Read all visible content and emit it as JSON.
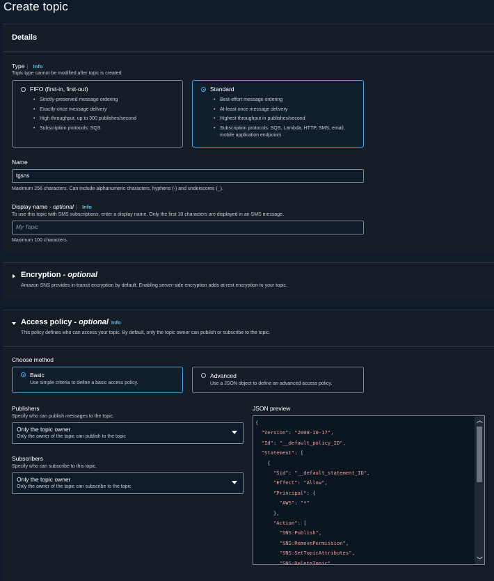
{
  "page": {
    "title": "Create topic"
  },
  "details": {
    "heading": "Details",
    "type": {
      "label": "Type",
      "info": "Info",
      "desc": "Topic type cannot be modified after topic is created",
      "fifo": {
        "title": "FIFO (first-in, first-out)",
        "bullets": [
          "Strictly-preserved message ordering",
          "Exactly-once message delivery",
          "High throughput, up to 300 publishes/second",
          "Subscription protocols: SQS"
        ]
      },
      "standard": {
        "title": "Standard",
        "bullets": [
          "Best-effort message ordering",
          "At-least once message delivery",
          "Highest throughput in publishes/second",
          "Subscription protocols: SQS, Lambda, HTTP, SMS, email, mobile application endpoints"
        ]
      }
    },
    "name": {
      "label": "Name",
      "value": "tgsns",
      "hint": "Maximum 256 characters. Can include alphanumeric characters, hyphens (-) and underscores (_)."
    },
    "display_name": {
      "label": "Display name",
      "optional": "optional",
      "info": "Info",
      "desc": "To use this topic with SMS subscriptions, enter a display name. Only the first 10 characters are displayed in an SMS message.",
      "placeholder": "My Topic",
      "hint": "Maximum 100 characters."
    }
  },
  "encryption": {
    "heading": "Encryption",
    "optional": "optional",
    "desc": "Amazon SNS provides in-transit encryption by default. Enabling server-side encryption adds at-rest encryption to your topic."
  },
  "access_policy": {
    "heading": "Access policy",
    "optional": "optional",
    "info": "Info",
    "desc": "This policy defines who can access your topic. By default, only the topic owner can publish or subscribe to the topic.",
    "choose_method": "Choose method",
    "basic": {
      "title": "Basic",
      "desc": "Use simple criteria to define a basic access policy."
    },
    "advanced": {
      "title": "Advanced",
      "desc": "Use a JSON object to define an advanced access policy."
    },
    "publishers": {
      "label": "Publishers",
      "desc": "Specify who can publish messages to the topic.",
      "selected_title": "Only the topic owner",
      "selected_desc": "Only the owner of the topic can publish to the topic"
    },
    "subscribers": {
      "label": "Subscribers",
      "desc": "Specify who can subscribe to this topic.",
      "selected_title": "Only the topic owner",
      "selected_desc": "Only the owner of the topic can subscribe to the topic"
    },
    "json_preview": {
      "label": "JSON preview",
      "lines": [
        "{",
        "  \"Version\": \"2008-10-17\",",
        "  \"Id\": \"__default_policy_ID\",",
        "  \"Statement\": [",
        "    {",
        "      \"Sid\": \"__default_statement_ID\",",
        "      \"Effect\": \"Allow\",",
        "      \"Principal\": {",
        "        \"AWS\": \"*\"",
        "      },",
        "      \"Action\": [",
        "        \"SNS:Publish\",",
        "        \"SNS:RemovePermission\",",
        "        \"SNS:SetTopicAttributes\",",
        "        \"SNS:DeleteTopic\","
      ]
    }
  },
  "colors": {
    "accent": "#4aa8e6",
    "info": "#5bc0ea",
    "background": "#0f1b2a",
    "panel": "#161d26"
  }
}
